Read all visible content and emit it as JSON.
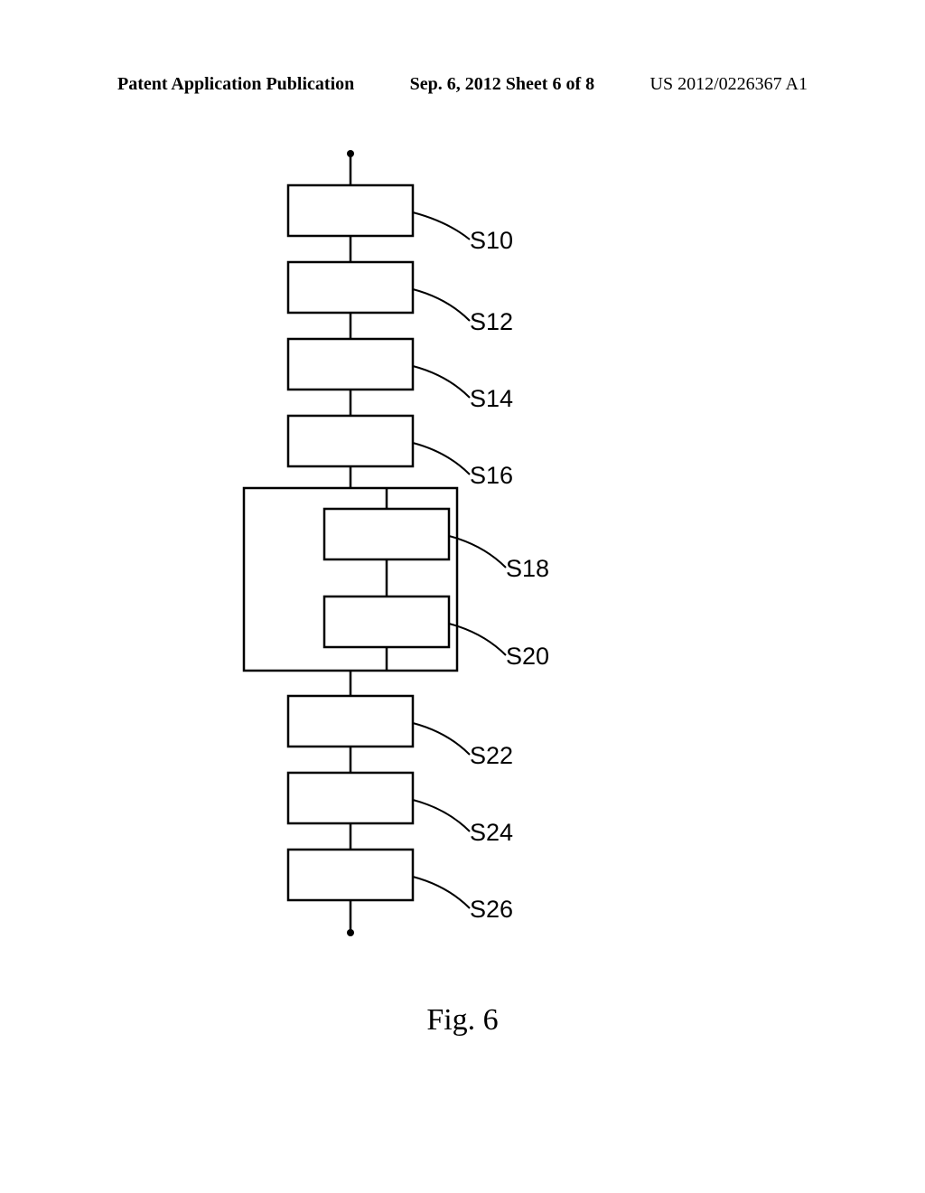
{
  "header": {
    "left": "Patent Application Publication",
    "center": "Sep. 6, 2012  Sheet 6 of 8",
    "right": "US 2012/0226367 A1"
  },
  "figure_caption": "Fig. 6",
  "labels": {
    "s10": "S10",
    "s12": "S12",
    "s14": "S14",
    "s16": "S16",
    "s18": "S18",
    "s20": "S20",
    "s22": "S22",
    "s24": "S24",
    "s26": "S26"
  }
}
